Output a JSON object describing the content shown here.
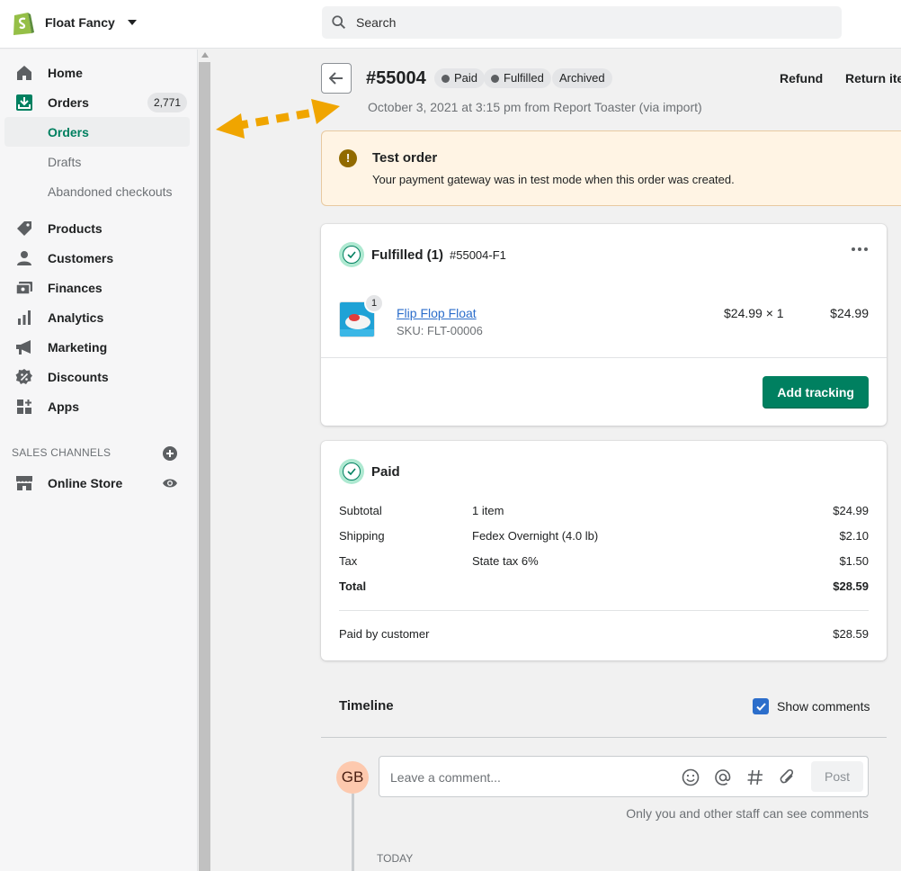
{
  "store": {
    "name": "Float Fancy"
  },
  "search": {
    "placeholder": "Search"
  },
  "sidebar": {
    "items": [
      {
        "label": "Home",
        "icon": "home-icon"
      },
      {
        "label": "Orders",
        "icon": "orders-icon",
        "count": "2,771"
      },
      {
        "label": "Orders",
        "sub": true,
        "active": true
      },
      {
        "label": "Drafts",
        "sub": true
      },
      {
        "label": "Abandoned checkouts",
        "sub": true
      },
      {
        "label": "Products",
        "icon": "tag-icon"
      },
      {
        "label": "Customers",
        "icon": "person-icon"
      },
      {
        "label": "Finances",
        "icon": "finances-icon"
      },
      {
        "label": "Analytics",
        "icon": "bar-chart-icon"
      },
      {
        "label": "Marketing",
        "icon": "megaphone-icon"
      },
      {
        "label": "Discounts",
        "icon": "discount-icon"
      },
      {
        "label": "Apps",
        "icon": "apps-icon"
      }
    ],
    "sales_channels_heading": "SALES CHANNELS",
    "online_store": "Online Store"
  },
  "order": {
    "title": "#55004",
    "badges": [
      "Paid",
      "Fulfilled",
      "Archived"
    ],
    "subtitle": "October 3, 2021 at 3:15 pm from Report Toaster (via import)",
    "actions": {
      "refund": "Refund",
      "return": "Return ite"
    }
  },
  "banner": {
    "title": "Test order",
    "text": "Your payment gateway was in test mode when this order was created."
  },
  "fulfilled_card": {
    "title": "Fulfilled",
    "count": "(1)",
    "id": "#55004-F1",
    "item": {
      "qty": "1",
      "name": "Flip Flop Float",
      "sku": "SKU: FLT-00006",
      "price": "$24.99 × 1",
      "total": "$24.99"
    },
    "button": "Add tracking"
  },
  "paid_card": {
    "title": "Paid",
    "rows": [
      {
        "label": "Subtotal",
        "desc": "1 item",
        "amount": "$24.99"
      },
      {
        "label": "Shipping",
        "desc": "Fedex Overnight (4.0 lb)",
        "amount": "$2.10"
      },
      {
        "label": "Tax",
        "desc": "State tax 6%",
        "amount": "$1.50"
      },
      {
        "label": "Total",
        "desc": "",
        "amount": "$28.59"
      }
    ],
    "paid_by": {
      "label": "Paid by customer",
      "amount": "$28.59"
    }
  },
  "timeline": {
    "title": "Timeline",
    "show_comments": "Show comments",
    "avatar": "GB",
    "comment_placeholder": "Leave a comment...",
    "post": "Post",
    "note": "Only you and other staff can see comments",
    "today": "TODAY"
  },
  "colors": {
    "accent": "#008060",
    "link": "#2c6ecb",
    "annotation_arrow": "#f0a500"
  }
}
